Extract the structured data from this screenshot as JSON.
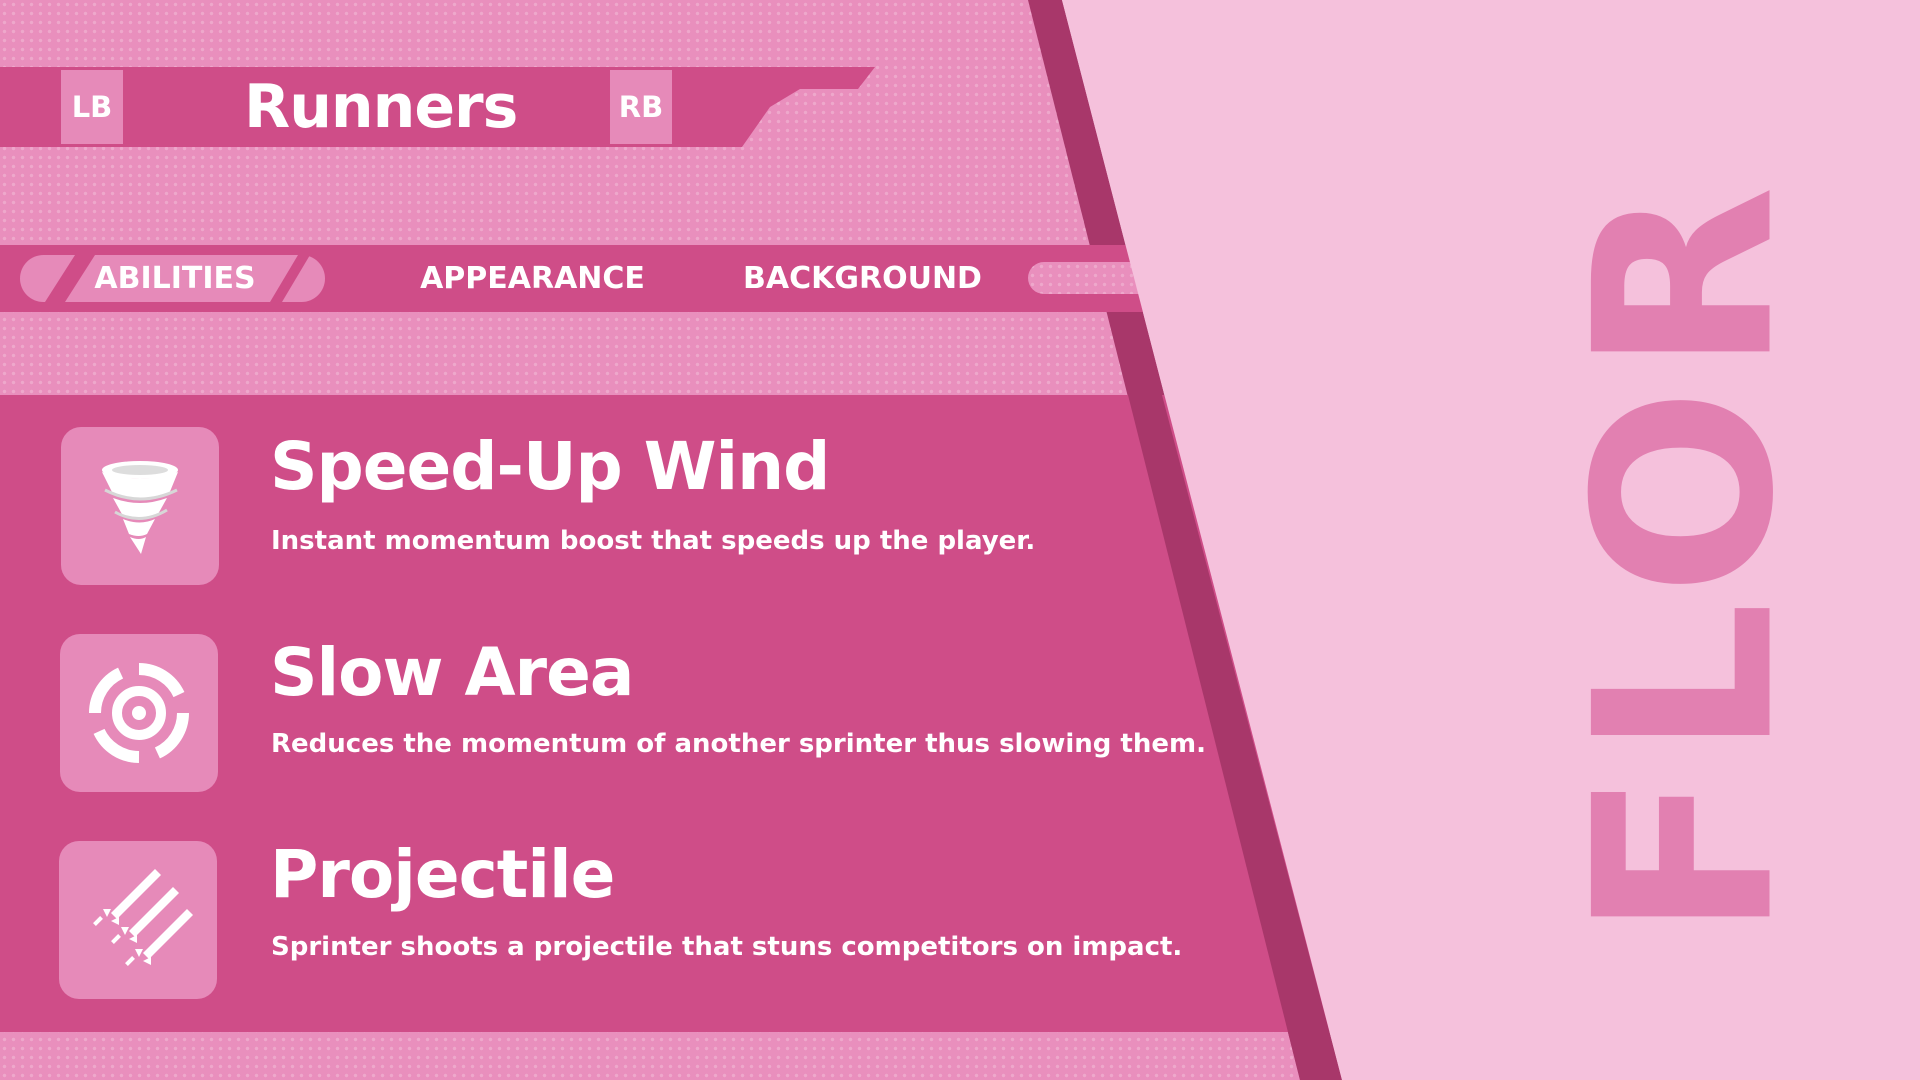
{
  "header": {
    "title": "Runners",
    "left_shoulder": "LB",
    "right_shoulder": "RB"
  },
  "tabs": [
    {
      "label": "ABILITIES",
      "active": true
    },
    {
      "label": "APPEARANCE",
      "active": false
    },
    {
      "label": "BACKGROUND",
      "active": false
    }
  ],
  "abilities": [
    {
      "name": "Speed-Up Wind",
      "description": "Instant momentum boost that speeds up the player.",
      "icon": "tornado-icon"
    },
    {
      "name": "Slow Area",
      "description": "Reduces the momentum of another sprinter thus slowing them.",
      "icon": "target-ring-icon"
    },
    {
      "name": "Projectile",
      "description": "Sprinter shoots a projectile that stuns competitors on impact.",
      "icon": "rockets-icon"
    }
  ],
  "character": {
    "name": "FLOR"
  },
  "colors": {
    "background": "#f5c1dc",
    "panel": "#cf4d88",
    "panel_light": "#e68ab9",
    "edge": "#a8376a",
    "name_text": "#e280b1"
  }
}
